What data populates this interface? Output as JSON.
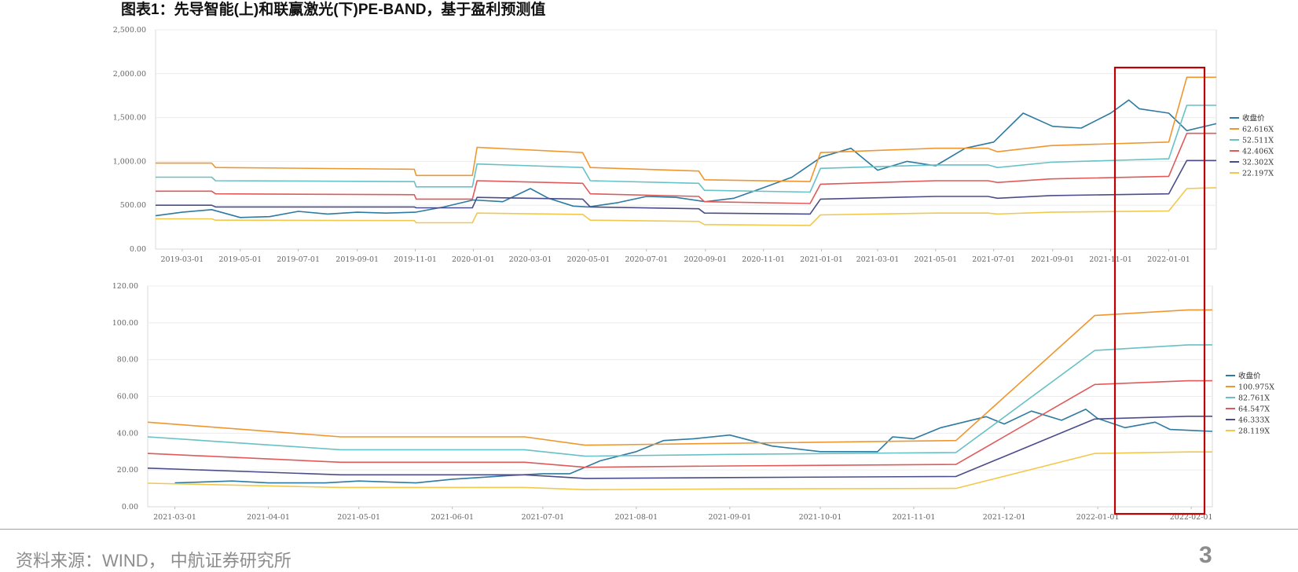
{
  "title": "图表1：先导智能(上)和联赢激光(下)PE-BAND，基于盈利预测值",
  "source": "资料来源：WIND， 中航证券研究所",
  "page_number": "3",
  "highlight_color": "#c00000",
  "chart_data": [
    {
      "type": "line",
      "x_ticks": [
        "2019-03-01",
        "2019-05-01",
        "2019-07-01",
        "2019-09-01",
        "2019-11-01",
        "2020-01-01",
        "2020-03-01",
        "2020-05-01",
        "2020-07-01",
        "2020-09-01",
        "2020-11-01",
        "2021-01-01",
        "2021-03-01",
        "2021-05-01",
        "2021-07-01",
        "2021-09-01",
        "2021-11-01",
        "2022-01-01"
      ],
      "y_ticks": [
        "0.00",
        "500.00",
        "1,000.00",
        "1,500.00",
        "2,000.00",
        "2,500.00"
      ],
      "ylim": [
        0,
        2500
      ],
      "x_range": [
        "2019-02-01",
        "2022-02-20"
      ],
      "grid": true,
      "legend_position": "right",
      "series": [
        {
          "name": "收盘价",
          "color": "#2e7aa0",
          "points": [
            [
              "2019-02-01",
              380
            ],
            [
              "2019-03-01",
              420
            ],
            [
              "2019-04-01",
              450
            ],
            [
              "2019-05-01",
              360
            ],
            [
              "2019-06-01",
              370
            ],
            [
              "2019-07-01",
              430
            ],
            [
              "2019-08-01",
              400
            ],
            [
              "2019-09-01",
              420
            ],
            [
              "2019-10-01",
              410
            ],
            [
              "2019-11-01",
              420
            ],
            [
              "2019-12-01",
              480
            ],
            [
              "2020-01-01",
              560
            ],
            [
              "2020-02-01",
              540
            ],
            [
              "2020-03-01",
              690
            ],
            [
              "2020-03-20",
              580
            ],
            [
              "2020-04-15",
              490
            ],
            [
              "2020-05-01",
              480
            ],
            [
              "2020-06-01",
              530
            ],
            [
              "2020-07-01",
              600
            ],
            [
              "2020-08-01",
              590
            ],
            [
              "2020-09-01",
              540
            ],
            [
              "2020-10-01",
              580
            ],
            [
              "2020-11-01",
              700
            ],
            [
              "2020-12-01",
              820
            ],
            [
              "2021-01-01",
              1050
            ],
            [
              "2021-02-01",
              1150
            ],
            [
              "2021-03-01",
              900
            ],
            [
              "2021-04-01",
              1000
            ],
            [
              "2021-05-01",
              950
            ],
            [
              "2021-06-01",
              1150
            ],
            [
              "2021-07-01",
              1220
            ],
            [
              "2021-08-01",
              1550
            ],
            [
              "2021-09-01",
              1400
            ],
            [
              "2021-10-01",
              1380
            ],
            [
              "2021-11-01",
              1550
            ],
            [
              "2021-11-20",
              1700
            ],
            [
              "2021-12-01",
              1600
            ],
            [
              "2022-01-01",
              1550
            ],
            [
              "2022-01-20",
              1350
            ],
            [
              "2022-02-20",
              1430
            ]
          ]
        },
        {
          "name": "62.616X",
          "color": "#f0962e",
          "points": [
            [
              "2019-02-01",
              980
            ],
            [
              "2019-04-01",
              980
            ],
            [
              "2019-04-05",
              930
            ],
            [
              "2019-10-31",
              910
            ],
            [
              "2019-11-02",
              840
            ],
            [
              "2019-12-31",
              840
            ],
            [
              "2020-01-05",
              1160
            ],
            [
              "2020-04-25",
              1100
            ],
            [
              "2020-05-03",
              930
            ],
            [
              "2020-08-25",
              890
            ],
            [
              "2020-08-31",
              790
            ],
            [
              "2020-12-20",
              770
            ],
            [
              "2020-12-31",
              1100
            ],
            [
              "2021-05-01",
              1150
            ],
            [
              "2021-06-25",
              1150
            ],
            [
              "2021-07-05",
              1110
            ],
            [
              "2021-08-30",
              1180
            ],
            [
              "2022-01-01",
              1220
            ],
            [
              "2022-01-20",
              1960
            ],
            [
              "2022-02-20",
              1960
            ]
          ]
        },
        {
          "name": "52.511X",
          "color": "#67c1c5",
          "points": [
            [
              "2019-02-01",
              820
            ],
            [
              "2019-04-01",
              820
            ],
            [
              "2019-04-05",
              780
            ],
            [
              "2019-10-31",
              770
            ],
            [
              "2019-11-02",
              710
            ],
            [
              "2019-12-31",
              710
            ],
            [
              "2020-01-05",
              970
            ],
            [
              "2020-04-25",
              930
            ],
            [
              "2020-05-03",
              780
            ],
            [
              "2020-08-25",
              750
            ],
            [
              "2020-08-31",
              670
            ],
            [
              "2020-12-20",
              650
            ],
            [
              "2020-12-31",
              920
            ],
            [
              "2021-05-01",
              960
            ],
            [
              "2021-06-25",
              960
            ],
            [
              "2021-07-05",
              930
            ],
            [
              "2021-08-30",
              990
            ],
            [
              "2022-01-01",
              1030
            ],
            [
              "2022-01-20",
              1640
            ],
            [
              "2022-02-20",
              1640
            ]
          ]
        },
        {
          "name": "42.406X",
          "color": "#e05a5a",
          "points": [
            [
              "2019-02-01",
              660
            ],
            [
              "2019-04-01",
              660
            ],
            [
              "2019-04-05",
              630
            ],
            [
              "2019-10-31",
              620
            ],
            [
              "2019-11-02",
              570
            ],
            [
              "2019-12-31",
              570
            ],
            [
              "2020-01-05",
              780
            ],
            [
              "2020-04-25",
              750
            ],
            [
              "2020-05-03",
              630
            ],
            [
              "2020-08-25",
              600
            ],
            [
              "2020-08-31",
              540
            ],
            [
              "2020-12-20",
              520
            ],
            [
              "2020-12-31",
              740
            ],
            [
              "2021-05-01",
              780
            ],
            [
              "2021-06-25",
              780
            ],
            [
              "2021-07-05",
              760
            ],
            [
              "2021-08-30",
              800
            ],
            [
              "2022-01-01",
              830
            ],
            [
              "2022-01-20",
              1320
            ],
            [
              "2022-02-20",
              1320
            ]
          ]
        },
        {
          "name": "32.302X",
          "color": "#4a4d8a",
          "points": [
            [
              "2019-02-01",
              500
            ],
            [
              "2019-04-01",
              500
            ],
            [
              "2019-04-05",
              480
            ],
            [
              "2019-10-31",
              480
            ],
            [
              "2019-11-02",
              470
            ],
            [
              "2019-12-31",
              470
            ],
            [
              "2020-01-05",
              590
            ],
            [
              "2020-04-25",
              570
            ],
            [
              "2020-05-03",
              480
            ],
            [
              "2020-08-25",
              460
            ],
            [
              "2020-08-31",
              410
            ],
            [
              "2020-12-20",
              400
            ],
            [
              "2020-12-31",
              570
            ],
            [
              "2021-05-01",
              600
            ],
            [
              "2021-06-25",
              600
            ],
            [
              "2021-07-05",
              580
            ],
            [
              "2021-08-30",
              610
            ],
            [
              "2022-01-01",
              630
            ],
            [
              "2022-01-20",
              1010
            ],
            [
              "2022-02-20",
              1010
            ]
          ]
        },
        {
          "name": "22.197X",
          "color": "#f2c84b",
          "points": [
            [
              "2019-02-01",
              345
            ],
            [
              "2019-04-01",
              345
            ],
            [
              "2019-04-05",
              330
            ],
            [
              "2019-10-31",
              325
            ],
            [
              "2019-11-02",
              300
            ],
            [
              "2019-12-31",
              300
            ],
            [
              "2020-01-05",
              410
            ],
            [
              "2020-04-25",
              395
            ],
            [
              "2020-05-03",
              330
            ],
            [
              "2020-08-25",
              315
            ],
            [
              "2020-08-31",
              280
            ],
            [
              "2020-12-20",
              270
            ],
            [
              "2020-12-31",
              390
            ],
            [
              "2021-05-01",
              410
            ],
            [
              "2021-06-25",
              410
            ],
            [
              "2021-07-05",
              400
            ],
            [
              "2021-08-30",
              420
            ],
            [
              "2022-01-01",
              435
            ],
            [
              "2022-01-20",
              690
            ],
            [
              "2022-02-20",
              700
            ]
          ]
        }
      ]
    },
    {
      "type": "line",
      "x_ticks": [
        "2021-03-01",
        "2021-04-01",
        "2021-05-01",
        "2021-06-01",
        "2021-07-01",
        "2021-08-01",
        "2021-09-01",
        "2021-10-01",
        "2021-11-01",
        "2021-12-01",
        "2022-01-01",
        "2022-02-01"
      ],
      "y_ticks": [
        "0.00",
        "20.00",
        "40.00",
        "60.00",
        "80.00",
        "100.00",
        "120.00"
      ],
      "ylim": [
        0,
        120
      ],
      "x_range": [
        "2021-02-20",
        "2022-02-08"
      ],
      "grid": true,
      "legend_position": "right",
      "series": [
        {
          "name": "收盘价",
          "color": "#2e7aa0",
          "points": [
            [
              "2021-03-01",
              13
            ],
            [
              "2021-03-20",
              14
            ],
            [
              "2021-04-01",
              13
            ],
            [
              "2021-04-20",
              13
            ],
            [
              "2021-05-01",
              14
            ],
            [
              "2021-05-20",
              13
            ],
            [
              "2021-06-01",
              15
            ],
            [
              "2021-06-20",
              17
            ],
            [
              "2021-07-01",
              18
            ],
            [
              "2021-07-10",
              18
            ],
            [
              "2021-07-20",
              25
            ],
            [
              "2021-08-01",
              30
            ],
            [
              "2021-08-10",
              36
            ],
            [
              "2021-08-20",
              37
            ],
            [
              "2021-09-01",
              39
            ],
            [
              "2021-09-15",
              33
            ],
            [
              "2021-10-01",
              30
            ],
            [
              "2021-10-20",
              30
            ],
            [
              "2021-10-25",
              38
            ],
            [
              "2021-11-01",
              37
            ],
            [
              "2021-11-10",
              43
            ],
            [
              "2021-11-25",
              49
            ],
            [
              "2021-12-01",
              45
            ],
            [
              "2021-12-10",
              52
            ],
            [
              "2021-12-20",
              47
            ],
            [
              "2021-12-28",
              53
            ],
            [
              "2022-01-01",
              48
            ],
            [
              "2022-01-10",
              43
            ],
            [
              "2022-01-20",
              46
            ],
            [
              "2022-01-25",
              42
            ],
            [
              "2022-02-08",
              41
            ]
          ]
        },
        {
          "name": "100.975X",
          "color": "#f0962e",
          "points": [
            [
              "2021-02-20",
              46
            ],
            [
              "2021-04-25",
              38
            ],
            [
              "2021-06-25",
              38
            ],
            [
              "2021-07-15",
              33.5
            ],
            [
              "2021-09-01",
              34.5
            ],
            [
              "2021-11-15",
              36
            ],
            [
              "2021-12-31",
              104
            ],
            [
              "2022-01-31",
              107
            ],
            [
              "2022-02-08",
              107
            ]
          ]
        },
        {
          "name": "82.761X",
          "color": "#67c1c5",
          "points": [
            [
              "2021-02-20",
              38
            ],
            [
              "2021-04-25",
              31
            ],
            [
              "2021-06-25",
              31
            ],
            [
              "2021-07-15",
              27.5
            ],
            [
              "2021-09-01",
              28.5
            ],
            [
              "2021-11-15",
              29.5
            ],
            [
              "2021-12-31",
              85
            ],
            [
              "2022-01-31",
              88
            ],
            [
              "2022-02-08",
              88
            ]
          ]
        },
        {
          "name": "64.547X",
          "color": "#e05a5a",
          "points": [
            [
              "2021-02-20",
              29
            ],
            [
              "2021-04-25",
              24.2
            ],
            [
              "2021-06-25",
              24.2
            ],
            [
              "2021-07-15",
              21.5
            ],
            [
              "2021-09-01",
              22.2
            ],
            [
              "2021-11-15",
              23
            ],
            [
              "2021-12-31",
              66.5
            ],
            [
              "2022-01-31",
              68.5
            ],
            [
              "2022-02-08",
              68.5
            ]
          ]
        },
        {
          "name": "46.333X",
          "color": "#4a4d8a",
          "points": [
            [
              "2021-02-20",
              21
            ],
            [
              "2021-04-25",
              17.4
            ],
            [
              "2021-06-25",
              17.4
            ],
            [
              "2021-07-15",
              15.4
            ],
            [
              "2021-09-01",
              15.9
            ],
            [
              "2021-11-15",
              16.5
            ],
            [
              "2021-12-31",
              47.7
            ],
            [
              "2022-01-31",
              49.2
            ],
            [
              "2022-02-08",
              49.2
            ]
          ]
        },
        {
          "name": "28.119X",
          "color": "#f2c84b",
          "points": [
            [
              "2021-02-20",
              12.8
            ],
            [
              "2021-04-25",
              10.5
            ],
            [
              "2021-06-25",
              10.5
            ],
            [
              "2021-07-15",
              9.3
            ],
            [
              "2021-09-01",
              9.7
            ],
            [
              "2021-11-15",
              10
            ],
            [
              "2021-12-31",
              29
            ],
            [
              "2022-01-31",
              29.8
            ],
            [
              "2022-02-08",
              29.8
            ]
          ]
        }
      ]
    }
  ]
}
